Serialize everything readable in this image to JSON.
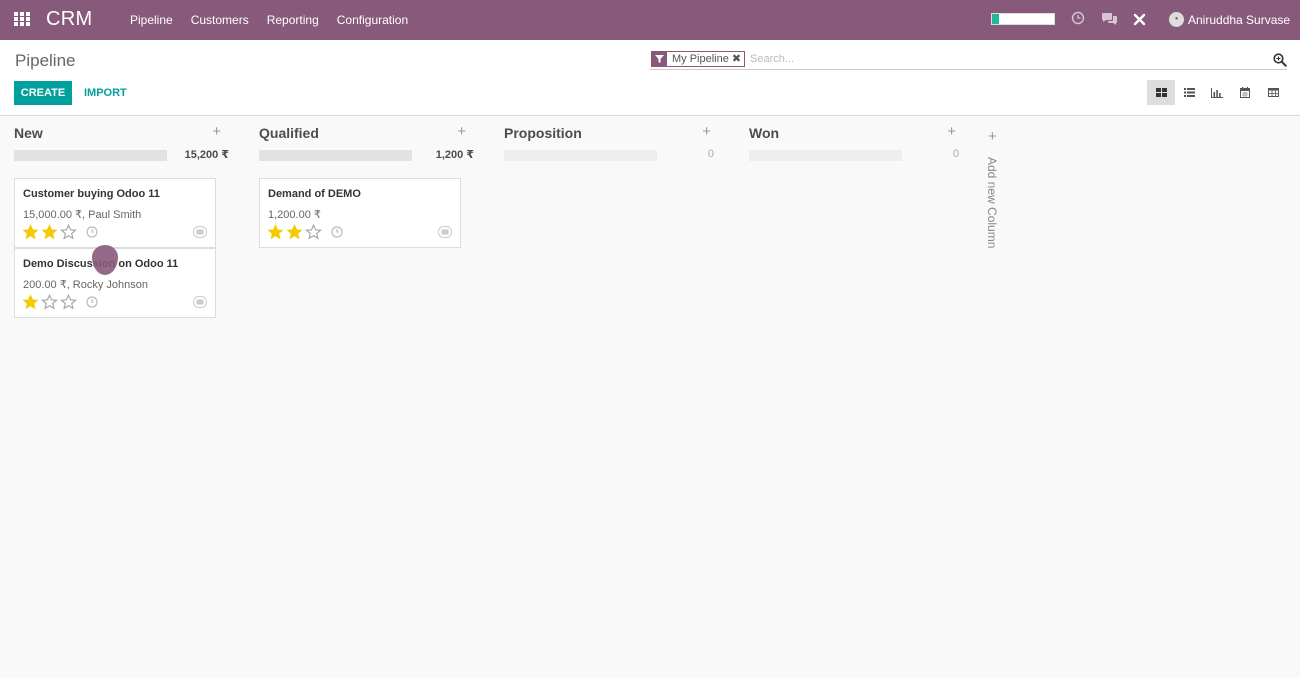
{
  "app": {
    "brand": "CRM"
  },
  "nav": {
    "menu": [
      "Pipeline",
      "Customers",
      "Reporting",
      "Configuration"
    ],
    "user_name": "Aniruddha Survase",
    "progress_fraction": 0.12
  },
  "control_panel": {
    "breadcrumb": "Pipeline",
    "facet_value": "My Pipeline",
    "facet_remove": "✖",
    "search_placeholder": "Search...",
    "create_label": "CREATE",
    "import_label": "IMPORT",
    "views": [
      "kanban",
      "list",
      "graph",
      "calendar",
      "pivot"
    ],
    "active_view": "kanban"
  },
  "columns": [
    {
      "title": "New",
      "total": "15,200 ₹",
      "cards": [
        {
          "title": "Customer buying Odoo 11",
          "subtitle": "15,000.00 ₹, Paul Smith",
          "priority": 2
        },
        {
          "title": "Demo Discussion on Odoo 11",
          "subtitle": "200.00 ₹, Rocky Johnson",
          "priority": 1
        }
      ]
    },
    {
      "title": "Qualified",
      "total": "1,200 ₹",
      "cards": [
        {
          "title": "Demand of DEMO",
          "subtitle": "1,200.00 ₹",
          "priority": 2
        }
      ]
    },
    {
      "title": "Proposition",
      "total": "0",
      "cards": []
    },
    {
      "title": "Won",
      "total": "0",
      "cards": []
    }
  ],
  "add_column": {
    "plus": "+",
    "label": "Add new Column"
  },
  "colors": {
    "brand": "#875a7b",
    "primary": "#00a09d",
    "star_on": "#f3cc00",
    "star_off": "#a8a8a8"
  }
}
